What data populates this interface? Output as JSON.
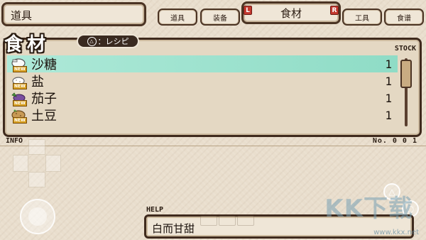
{
  "top_bar": {
    "category_title": "道具",
    "tabs": [
      {
        "label": "道具"
      },
      {
        "label": "装备"
      },
      {
        "label": "食材",
        "active": true
      },
      {
        "label": "工具"
      },
      {
        "label": "食谱"
      }
    ],
    "left_shoulder": "L",
    "right_shoulder": "R"
  },
  "list": {
    "header_title": "食材",
    "recipe_button": "：レシピ",
    "recipe_button_icon": "triangle-button-icon",
    "stock_label": "STOCK",
    "items": [
      {
        "name": "沙糖",
        "quantity": "1",
        "badge": "NEW",
        "icon": "sugar-icon"
      },
      {
        "name": "盐",
        "quantity": "1",
        "badge": "NEW",
        "icon": "salt-icon"
      },
      {
        "name": "茄子",
        "quantity": "1",
        "badge": "NEW",
        "icon": "eggplant-icon"
      },
      {
        "name": "土豆",
        "quantity": "1",
        "badge": "NEW",
        "icon": "potato-icon"
      }
    ],
    "selected_index": 0
  },
  "info": {
    "label": "INFO",
    "number_text": "No. 0 0 1"
  },
  "help": {
    "label": "HELP",
    "text": "白而甘甜"
  },
  "watermark": {
    "text": "KK下载",
    "url": "www.kkx.net"
  },
  "colors": {
    "selection": "#9fe3cf",
    "frame": "#3f2a1d",
    "panel": "#efe6d7",
    "shoulder_badge": "#c3392f"
  }
}
